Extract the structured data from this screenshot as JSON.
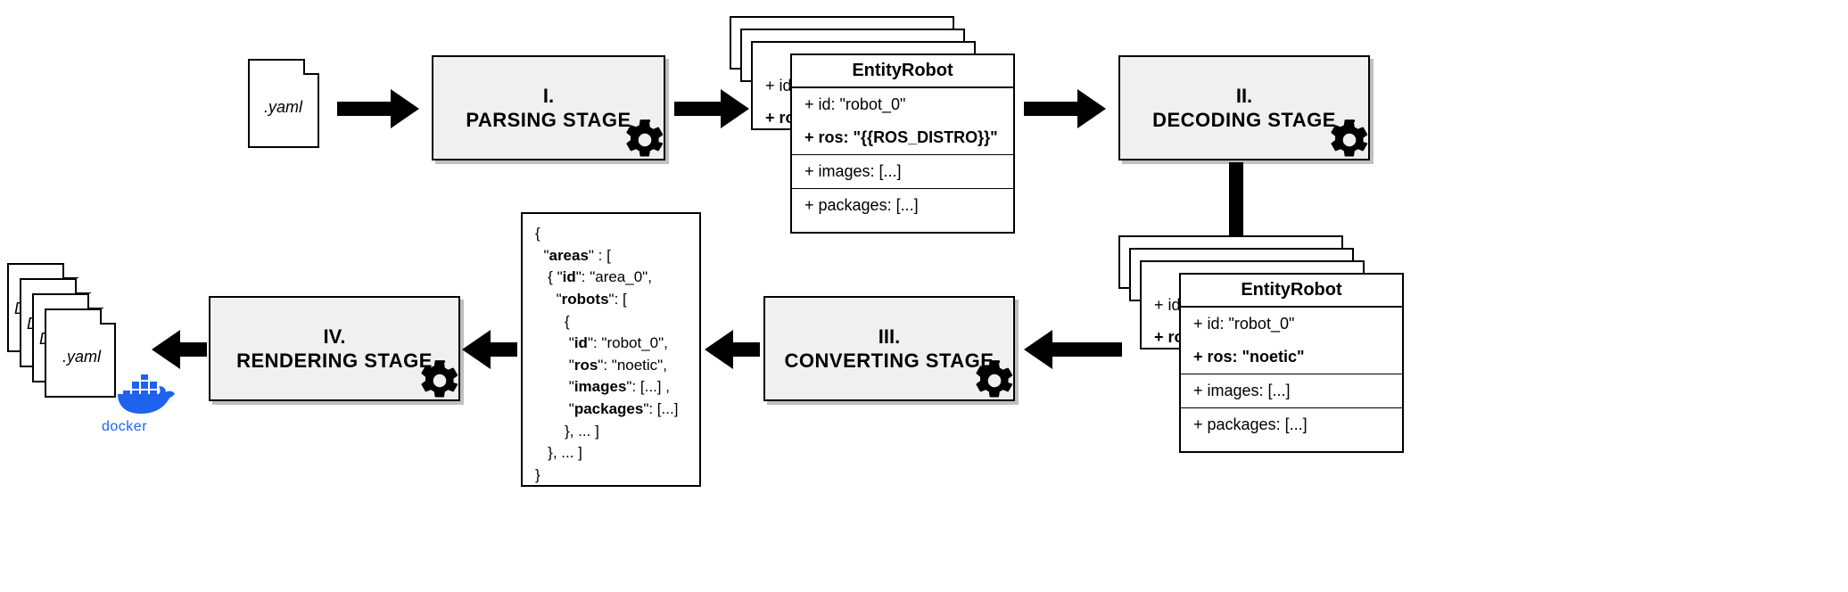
{
  "input_file": ".yaml",
  "stages": {
    "s1": {
      "num": "I.",
      "name": "PARSING STAGE"
    },
    "s2": {
      "num": "II.",
      "name": "DECODING STAGE"
    },
    "s3": {
      "num": "III.",
      "name": "CONVERTING STAGE"
    },
    "s4": {
      "num": "IV.",
      "name": "RENDERING STAGE"
    }
  },
  "entity1": {
    "title": "EntityRobot",
    "peek_id": "+ id:",
    "peek_ros": "+ ro",
    "id": "+ id: \"robot_0\"",
    "ros": "+ ros: \"{{ROS_DISTRO}}\"",
    "images": "+ images: [...]",
    "packages": "+ packages: [...]"
  },
  "entity2": {
    "title": "EntityRobot",
    "peek_id": "+ id:",
    "peek_ros": "+ ro",
    "id": "+ id: \"robot_0\"",
    "ros": "+ ros: \"noetic\"",
    "images": "+ images: [...]",
    "packages": "+ packages: [...]"
  },
  "json_dump": "{\n  \"areas\" : [\n   { \"id\": \"area_0\",\n     \"robots\": [\n       {\n        \"id\": \"robot_0\",\n        \"ros\": \"noetic\",\n        \"images\": [...] ,\n        \"packages\": [...]\n       }, ... ]\n   }, ... ]\n}",
  "json_bold_keys": [
    "areas",
    "id",
    "robots",
    "id",
    "ros",
    "images",
    "packages"
  ],
  "output": {
    "d1": "D",
    "d2": "D",
    "docker": "Dock",
    "yaml": ".yaml",
    "label": "docker"
  }
}
